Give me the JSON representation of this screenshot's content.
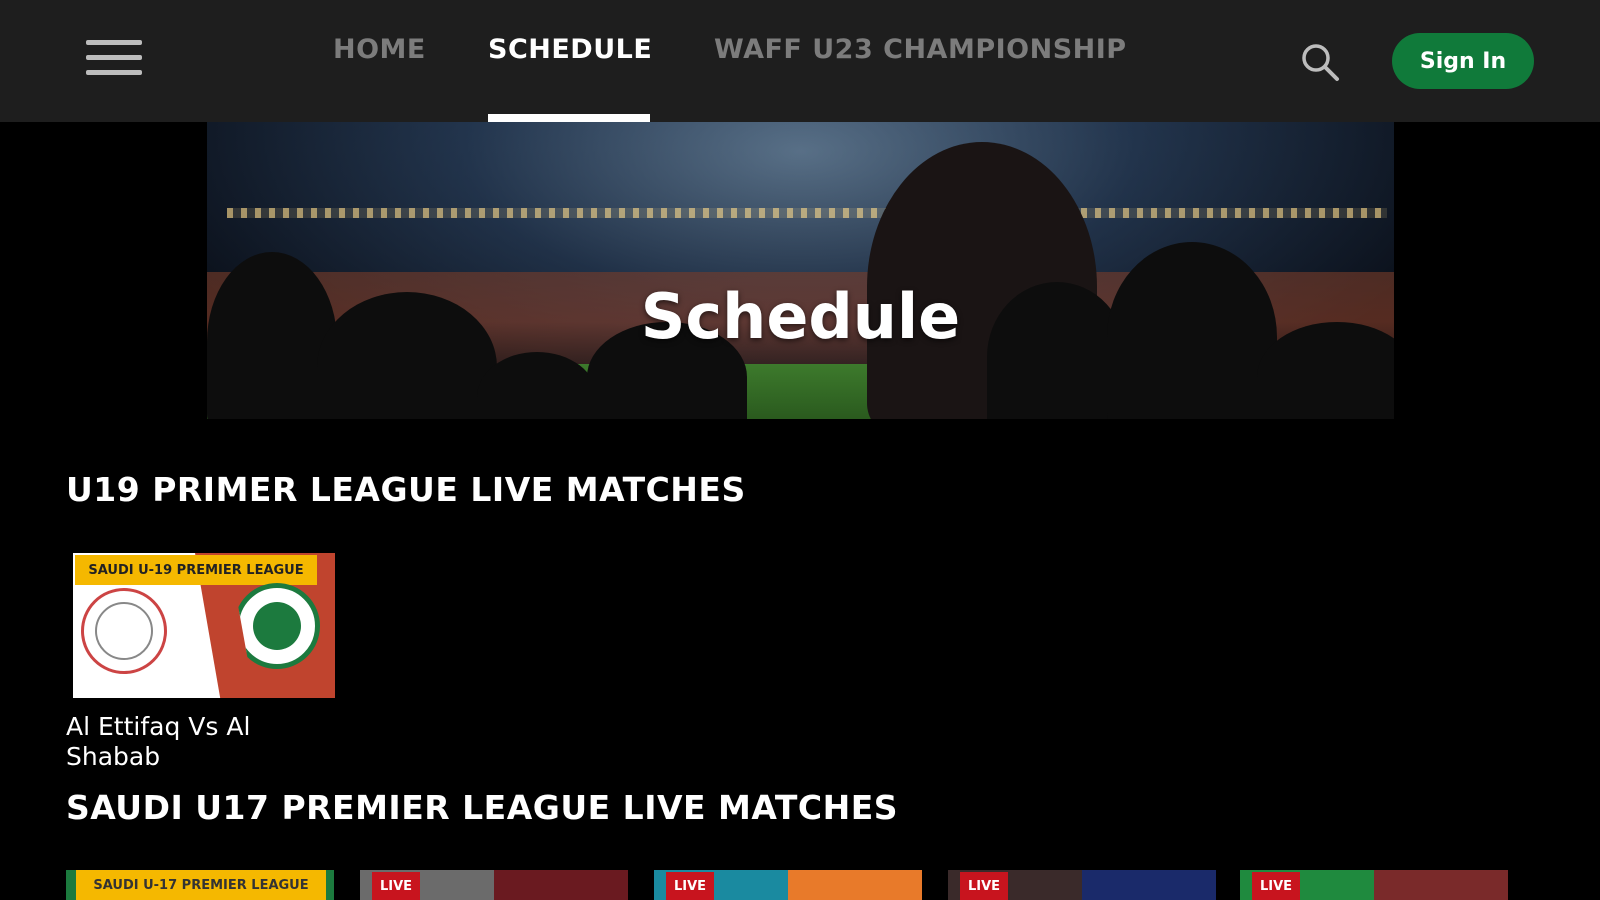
{
  "header": {
    "nav": [
      {
        "label": "HOME",
        "active": false
      },
      {
        "label": "SCHEDULE",
        "active": true
      },
      {
        "label": "WAFF U23 CHAMPIONSHIP",
        "active": false
      }
    ],
    "signin_label": "Sign In",
    "icons": {
      "menu": "hamburger-menu-icon",
      "search": "search-icon"
    },
    "colors": {
      "bar": "#1e1e1e",
      "signin": "#107a3a"
    }
  },
  "hero": {
    "title": "Schedule"
  },
  "sections": [
    {
      "title": "U19 PRIMER LEAGUE LIVE MATCHES",
      "matches": [
        {
          "league_tag": "SAUDI U-19 PREMIER LEAGUE",
          "title": "Al Ettifaq Vs Al Shabab"
        }
      ]
    },
    {
      "title": "SAUDI U17 PREMIER LEAGUE LIVE MATCHES",
      "thumbs": [
        {
          "tag": "SAUDI U-17 PREMIER LEAGUE",
          "live": ""
        },
        {
          "tag": "",
          "live": "LIVE"
        },
        {
          "tag": "",
          "live": "LIVE"
        },
        {
          "tag": "",
          "live": "LIVE"
        },
        {
          "tag": "",
          "live": "LIVE"
        }
      ]
    }
  ]
}
